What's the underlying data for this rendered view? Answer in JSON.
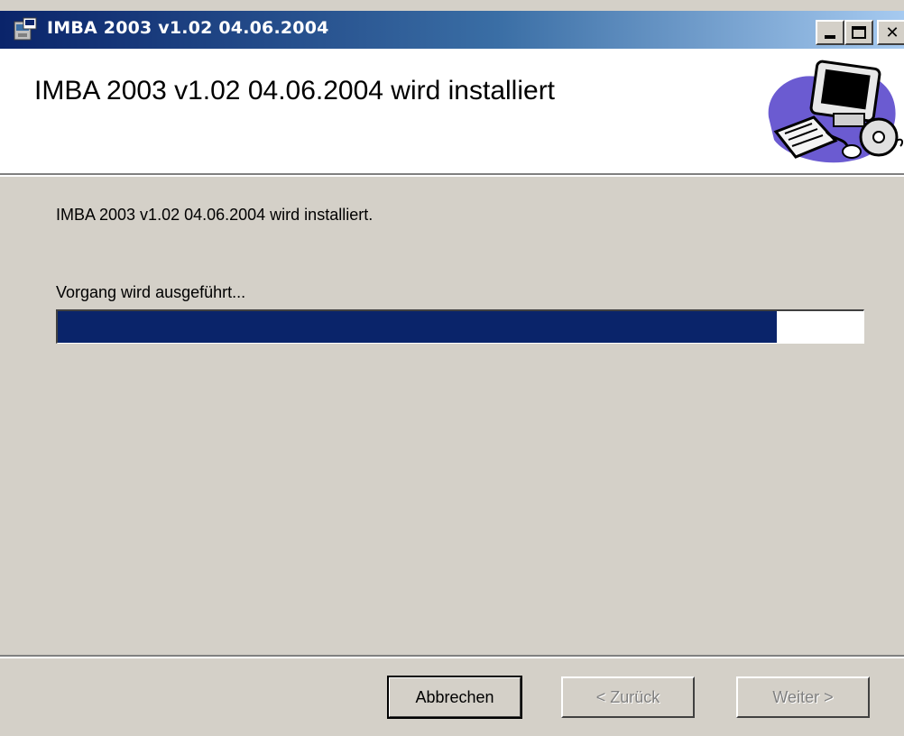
{
  "window": {
    "title": "IMBA 2003 v1.02 04.06.2004",
    "controls": {
      "minimize": "minimize-icon",
      "maximize": "maximize-icon",
      "close": "close-icon"
    },
    "close_glyph": "✕"
  },
  "banner": {
    "title": "IMBA 2003 v1.02 04.06.2004 wird installiert",
    "art": "computer-clipart-icon"
  },
  "body": {
    "status_text": "IMBA 2003 v1.02 04.06.2004 wird installiert.",
    "action_text": "Vorgang wird ausgeführt...",
    "progress_fraction": 0.893
  },
  "buttons": {
    "cancel": "Abbrechen",
    "back": "< Zurück",
    "next": "Weiter >"
  },
  "colors": {
    "titlebar_start": "#0a246a",
    "titlebar_end": "#a6caf0",
    "progress_fill": "#0a246a",
    "dialog_bg": "#d4d0c8"
  }
}
